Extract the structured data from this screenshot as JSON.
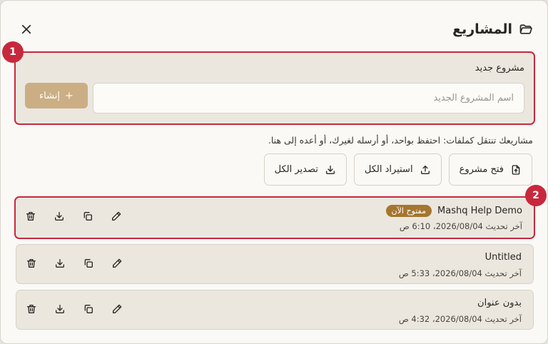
{
  "header": {
    "title": "المشاريع",
    "icon": "folder-open-icon",
    "close_icon": "close-icon"
  },
  "new_project": {
    "label": "مشروع جديد",
    "input_placeholder": "اسم المشروع الجديد",
    "input_value": "",
    "create_label": "إنشاء",
    "create_icon": "plus-icon"
  },
  "annotations": [
    "1",
    "2"
  ],
  "hint": "مشاريعك تنتقل كملفات: احتفظ بواحد، أو أرسله لغيرك، أو أعده إلى هنا.",
  "actions": [
    {
      "label": "فتح مشروع",
      "icon": "file-upload-icon"
    },
    {
      "label": "استيراد الكل",
      "icon": "upload-icon"
    },
    {
      "label": "تصدير الكل",
      "icon": "download-icon"
    }
  ],
  "projects": [
    {
      "name": "Mashq Help Demo",
      "badge": "مفتوح الآن",
      "date": "آخر تحديث 2026/08/04، 6:10 ص"
    },
    {
      "name": "Untitled",
      "badge": "",
      "date": "آخر تحديث 2026/08/04، 5:33 ص"
    },
    {
      "name": "بدون عنوان",
      "badge": "",
      "date": "آخر تحديث 2026/08/04، 4:32 ص"
    }
  ],
  "colors": {
    "accent": "#c8283c",
    "create_button": "#cbae84",
    "open_badge": "#a4762f"
  }
}
